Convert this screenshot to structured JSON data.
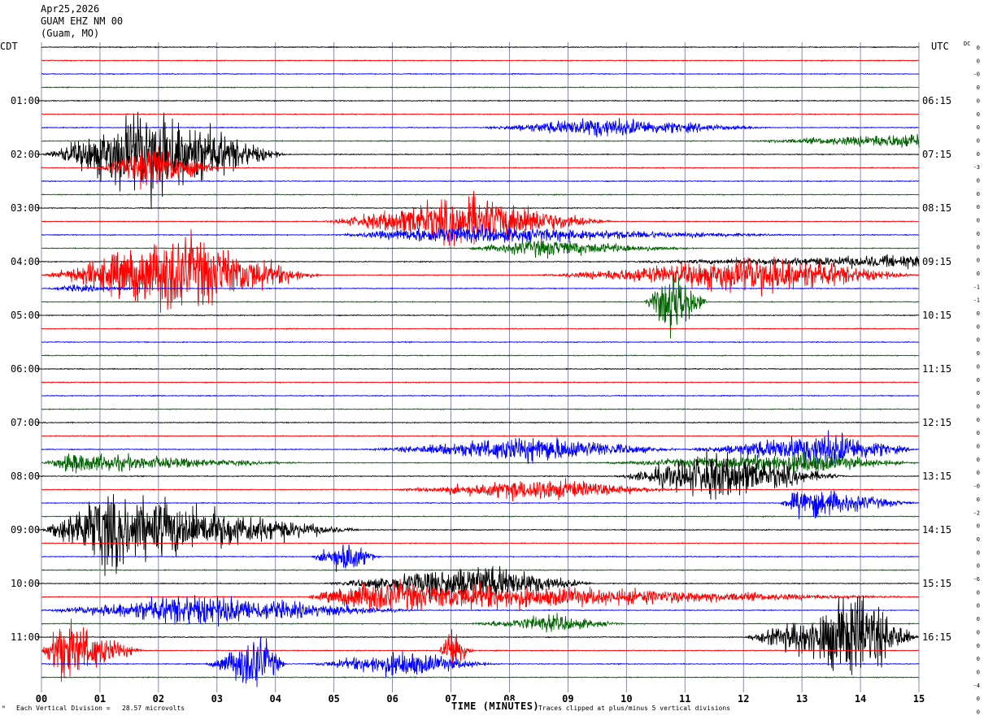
{
  "header": {
    "date": "Apr25,2026",
    "station": "GUAM EHZ NM 00",
    "location": "(Guam, MO)"
  },
  "left_zone": "CDT",
  "right_zone": "UTC",
  "dc_label": "DC",
  "footer": {
    "scale_text": "Each Vertical Division =   28.57 microvolts",
    "clip_text": "Traces clipped at plus/minus 5 vertical divisions",
    "corner_mark": "ᴹ"
  },
  "colors": [
    "#000000",
    "#ff0000",
    "#0000ff",
    "#006400"
  ],
  "chart_data": {
    "type": "line",
    "title": "Apr25,2026 GUAM EHZ NM 00 (Guam, MO)",
    "xlabel": "TIME (MINUTES)",
    "x_ticks": [
      "00",
      "01",
      "02",
      "03",
      "04",
      "05",
      "06",
      "07",
      "08",
      "09",
      "10",
      "11",
      "12",
      "13",
      "14",
      "15"
    ],
    "xlim": [
      0,
      15
    ],
    "row_minutes": 15,
    "rows_count": 48,
    "left_time_labels": [
      {
        "row": 4,
        "label": "01:00"
      },
      {
        "row": 8,
        "label": "02:00"
      },
      {
        "row": 12,
        "label": "03:00"
      },
      {
        "row": 16,
        "label": "04:00"
      },
      {
        "row": 20,
        "label": "05:00"
      },
      {
        "row": 24,
        "label": "06:00"
      },
      {
        "row": 28,
        "label": "07:00"
      },
      {
        "row": 32,
        "label": "08:00"
      },
      {
        "row": 36,
        "label": "09:00"
      },
      {
        "row": 40,
        "label": "10:00"
      },
      {
        "row": 44,
        "label": "11:00"
      }
    ],
    "right_time_labels": [
      {
        "row": 4,
        "label": "06:15"
      },
      {
        "row": 8,
        "label": "07:15"
      },
      {
        "row": 12,
        "label": "08:15"
      },
      {
        "row": 16,
        "label": "09:15"
      },
      {
        "row": 20,
        "label": "10:15"
      },
      {
        "row": 24,
        "label": "11:15"
      },
      {
        "row": 28,
        "label": "12:15"
      },
      {
        "row": 32,
        "label": "13:15"
      },
      {
        "row": 36,
        "label": "14:15"
      },
      {
        "row": 40,
        "label": "15:15"
      },
      {
        "row": 44,
        "label": "16:15"
      }
    ],
    "dc_offsets": [
      "0",
      "0",
      "-0",
      "0",
      "0",
      "0",
      "0",
      "0",
      "0",
      "-3",
      "0",
      "0",
      "0",
      "0",
      "0",
      "0",
      "0",
      "0",
      "-1",
      "-1",
      "0",
      "0",
      "0",
      "0",
      "0",
      "0",
      "0",
      "0",
      "0",
      "0",
      "0",
      "0",
      "0",
      "-0",
      "0",
      "-2",
      "0",
      "0",
      "0",
      "0",
      "-6",
      "0",
      "0",
      "0",
      "0",
      "0",
      "0",
      "0",
      "-4",
      "0",
      "0",
      "-4",
      "0",
      "0"
    ],
    "events": [
      {
        "row": 8,
        "start": 0.0,
        "peak": 1.9,
        "end": 4.2,
        "amp": 4.5
      },
      {
        "row": 9,
        "start": 0.9,
        "peak": 1.9,
        "end": 3.1,
        "amp": 2.0
      },
      {
        "row": 6,
        "start": 7.5,
        "peak": 9.5,
        "end": 12.5,
        "amp": 0.9
      },
      {
        "row": 7,
        "start": 12.0,
        "peak": 15.0,
        "end": 15.0,
        "amp": 0.7
      },
      {
        "row": 13,
        "start": 4.8,
        "peak": 7.3,
        "end": 9.8,
        "amp": 2.4
      },
      {
        "row": 14,
        "start": 5.0,
        "peak": 6.8,
        "end": 13.0,
        "amp": 0.8
      },
      {
        "row": 15,
        "start": 7.2,
        "peak": 8.5,
        "end": 11.2,
        "amp": 0.8
      },
      {
        "row": 16,
        "start": 9.8,
        "peak": 15.0,
        "end": 15.0,
        "amp": 0.6
      },
      {
        "row": 17,
        "start": 0.0,
        "peak": 2.3,
        "end": 4.8,
        "amp": 3.8
      },
      {
        "row": 17,
        "start": 8.5,
        "peak": 12.5,
        "end": 15.0,
        "amp": 1.8
      },
      {
        "row": 18,
        "start": 0.0,
        "peak": 0.6,
        "end": 1.8,
        "amp": 0.3
      },
      {
        "row": 19,
        "start": 10.3,
        "peak": 10.8,
        "end": 11.4,
        "amp": 3.5
      },
      {
        "row": 30,
        "start": 5.5,
        "peak": 8.5,
        "end": 11.0,
        "amp": 1.2
      },
      {
        "row": 30,
        "start": 11.0,
        "peak": 13.5,
        "end": 15.0,
        "amp": 1.6
      },
      {
        "row": 31,
        "start": 0.0,
        "peak": 0.5,
        "end": 4.5,
        "amp": 0.9
      },
      {
        "row": 31,
        "start": 9.5,
        "peak": 13.0,
        "end": 15.0,
        "amp": 1.0
      },
      {
        "row": 32,
        "start": 9.8,
        "peak": 11.5,
        "end": 13.8,
        "amp": 2.2
      },
      {
        "row": 33,
        "start": 6.0,
        "peak": 8.5,
        "end": 11.0,
        "amp": 1.0
      },
      {
        "row": 34,
        "start": 12.6,
        "peak": 13.0,
        "end": 15.0,
        "amp": 1.5
      },
      {
        "row": 36,
        "start": 0.0,
        "peak": 1.0,
        "end": 5.5,
        "amp": 3.5
      },
      {
        "row": 38,
        "start": 4.6,
        "peak": 5.2,
        "end": 5.8,
        "amp": 1.6
      },
      {
        "row": 40,
        "start": 4.8,
        "peak": 7.5,
        "end": 9.5,
        "amp": 1.8
      },
      {
        "row": 41,
        "start": 4.5,
        "peak": 5.5,
        "end": 15.0,
        "amp": 1.4
      },
      {
        "row": 42,
        "start": 0.0,
        "peak": 2.5,
        "end": 6.5,
        "amp": 1.4
      },
      {
        "row": 43,
        "start": 7.3,
        "peak": 8.7,
        "end": 10.0,
        "amp": 0.8
      },
      {
        "row": 44,
        "start": 12.0,
        "peak": 14.0,
        "end": 15.0,
        "amp": 4.0
      },
      {
        "row": 45,
        "start": 0.0,
        "peak": 0.3,
        "end": 1.8,
        "amp": 3.0
      },
      {
        "row": 45,
        "start": 6.8,
        "peak": 7.0,
        "end": 7.4,
        "amp": 2.5
      },
      {
        "row": 46,
        "start": 2.8,
        "peak": 3.7,
        "end": 4.2,
        "amp": 2.8
      },
      {
        "row": 46,
        "start": 4.5,
        "peak": 6.2,
        "end": 7.8,
        "amp": 1.2
      }
    ]
  }
}
